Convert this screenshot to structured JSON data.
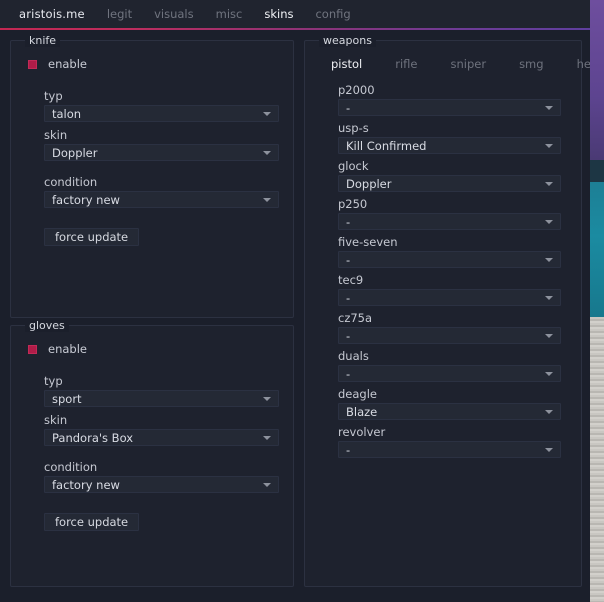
{
  "menubar": {
    "brand": "aristois.me",
    "items": [
      {
        "label": "legit",
        "active": false
      },
      {
        "label": "visuals",
        "active": false
      },
      {
        "label": "misc",
        "active": false
      },
      {
        "label": "skins",
        "active": true
      },
      {
        "label": "config",
        "active": false
      }
    ]
  },
  "accent": {
    "from": "#c32752",
    "to": "#5f3f9e"
  },
  "knife": {
    "legend": "knife",
    "enable_label": "enable",
    "enabled": true,
    "typ_label": "typ",
    "typ_value": "talon",
    "skin_label": "skin",
    "skin_value": "Doppler",
    "condition_label": "condition",
    "condition_value": "factory new",
    "force_update_label": "force update"
  },
  "gloves": {
    "legend": "gloves",
    "enable_label": "enable",
    "enabled": true,
    "typ_label": "typ",
    "typ_value": "sport",
    "skin_label": "skin",
    "skin_value": "Pandora's Box",
    "condition_label": "condition",
    "condition_value": "factory new",
    "force_update_label": "force update"
  },
  "weapons": {
    "legend": "weapons",
    "tabs": [
      {
        "label": "pistol",
        "active": true
      },
      {
        "label": "rifle",
        "active": false
      },
      {
        "label": "sniper",
        "active": false
      },
      {
        "label": "smg",
        "active": false
      },
      {
        "label": "heavy",
        "active": false
      }
    ],
    "items": [
      {
        "name": "p2000",
        "skin": "-"
      },
      {
        "name": "usp-s",
        "skin": "Kill Confirmed"
      },
      {
        "name": "glock",
        "skin": "Doppler"
      },
      {
        "name": "p250",
        "skin": "-"
      },
      {
        "name": "five-seven",
        "skin": "-"
      },
      {
        "name": "tec9",
        "skin": "-"
      },
      {
        "name": "cz75a",
        "skin": "-"
      },
      {
        "name": "duals",
        "skin": "-"
      },
      {
        "name": "deagle",
        "skin": "Blaze"
      },
      {
        "name": "revolver",
        "skin": "-"
      }
    ]
  }
}
